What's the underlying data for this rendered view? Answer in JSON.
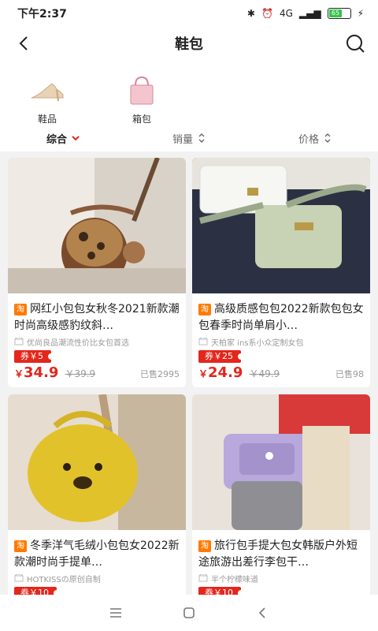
{
  "status": {
    "time": "下午2:37",
    "network": "4G",
    "battery": "65"
  },
  "header": {
    "title": "鞋包"
  },
  "categories": [
    {
      "label": "鞋品",
      "icon": "shoe-icon"
    },
    {
      "label": "箱包",
      "icon": "handbag-icon"
    }
  ],
  "sort": [
    {
      "label": "综合",
      "active": true,
      "icon": "chevron-down-icon"
    },
    {
      "label": "销量",
      "active": false,
      "icon": "sort-updown-icon"
    },
    {
      "label": "价格",
      "active": false,
      "icon": "sort-updown-icon"
    }
  ],
  "products": [
    {
      "title": "网红小包包女秋冬2021新款潮时尚高级感豹纹斜…",
      "shop": "优尚良品潮流性价比女包首选",
      "coupon": "券￥5",
      "price_symbol": "￥",
      "price": "34.9",
      "original": "￥39.9",
      "sold": "已售2995"
    },
    {
      "title": "高级质感包包2022新款包包女包春季时尚单肩小…",
      "shop": "天柏家 ins系小众定制女包",
      "coupon": "券￥25",
      "price_symbol": "￥",
      "price": "24.9",
      "original": "￥49.9",
      "sold": "已售98"
    },
    {
      "title": "冬季洋气毛绒小包包女2022新款潮时尚手提单…",
      "shop": "HOTKISSの原创自制",
      "coupon": "券￥10",
      "price_symbol": "",
      "price": "",
      "original": "",
      "sold": ""
    },
    {
      "title": "旅行包手提大包女韩版户外短途旅游出差行李包干…",
      "shop": "半个柠檬味道",
      "coupon": "券￥10",
      "price_symbol": "",
      "price": "",
      "original": "",
      "sold": ""
    }
  ],
  "tmall_badge": "淘",
  "colors": {
    "accent": "#e4261c",
    "tmall": "#ff7a00"
  }
}
